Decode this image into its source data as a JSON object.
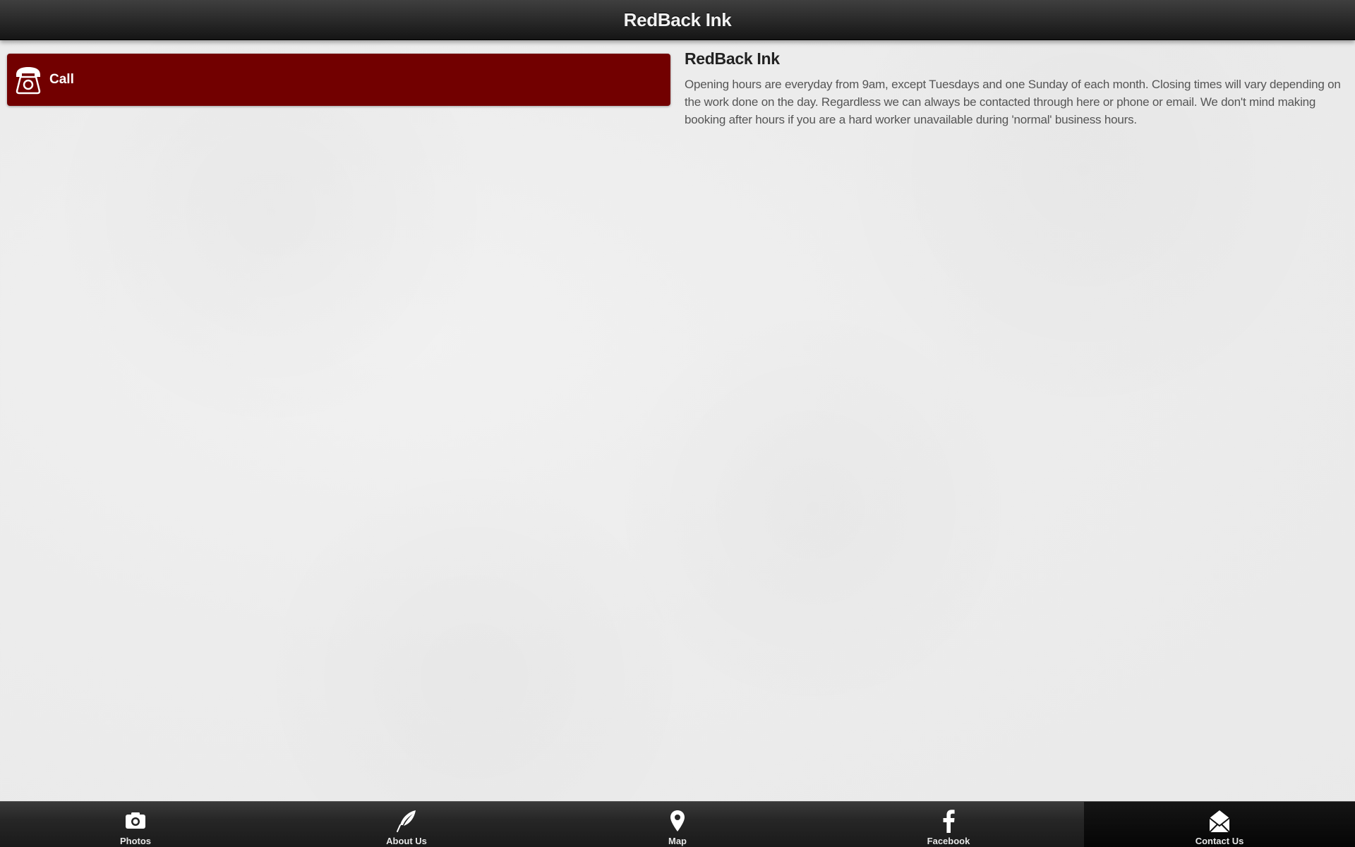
{
  "header": {
    "title": "RedBack Ink"
  },
  "call_button": {
    "label": "Call",
    "icon": "telephone-icon",
    "color": "#720000"
  },
  "info": {
    "title": "RedBack Ink",
    "text": "Opening hours are everyday from 9am, except Tuesdays and one Sunday of each month. Closing times will vary depending on the work done on the day. Regardless we can always be contacted through here or phone or email. We don't mind making booking after hours if you are a hard worker unavailable during 'normal' business hours."
  },
  "tabbar": {
    "tabs": [
      {
        "label": "Photos",
        "icon": "camera-icon"
      },
      {
        "label": "About Us",
        "icon": "feather-icon"
      },
      {
        "label": "Map",
        "icon": "map-pin-icon"
      },
      {
        "label": "Facebook",
        "icon": "facebook-icon"
      },
      {
        "label": "Contact Us",
        "icon": "envelope-icon",
        "active": true
      }
    ]
  }
}
